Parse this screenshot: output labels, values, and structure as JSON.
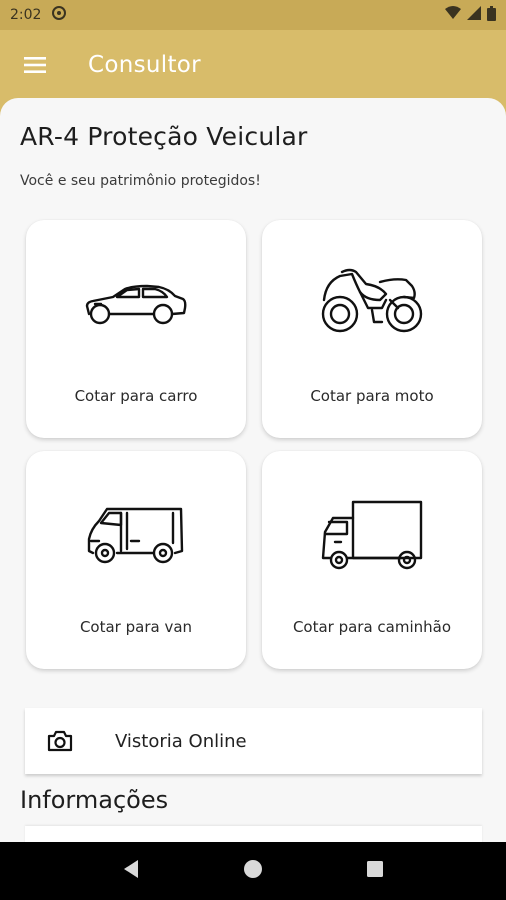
{
  "status_bar": {
    "time": "2:02"
  },
  "app_bar": {
    "title": "Consultor"
  },
  "header": {
    "title": "AR-4 Proteção Veicular",
    "subtitle": "Você e seu patrimônio protegidos!"
  },
  "quote_options": [
    {
      "label": "Cotar para carro",
      "icon": "car-icon"
    },
    {
      "label": "Cotar para moto",
      "icon": "motorcycle-icon"
    },
    {
      "label": "Cotar para van",
      "icon": "van-icon"
    },
    {
      "label": "Cotar para caminhão",
      "icon": "truck-icon"
    }
  ],
  "vistoria": {
    "label": "Vistoria Online",
    "icon": "camera-icon"
  },
  "info_section": {
    "title": "Informações"
  },
  "colors": {
    "accent": "#d8bc6a",
    "status_bar": "#c8aa57",
    "background": "#f7f7f7"
  }
}
